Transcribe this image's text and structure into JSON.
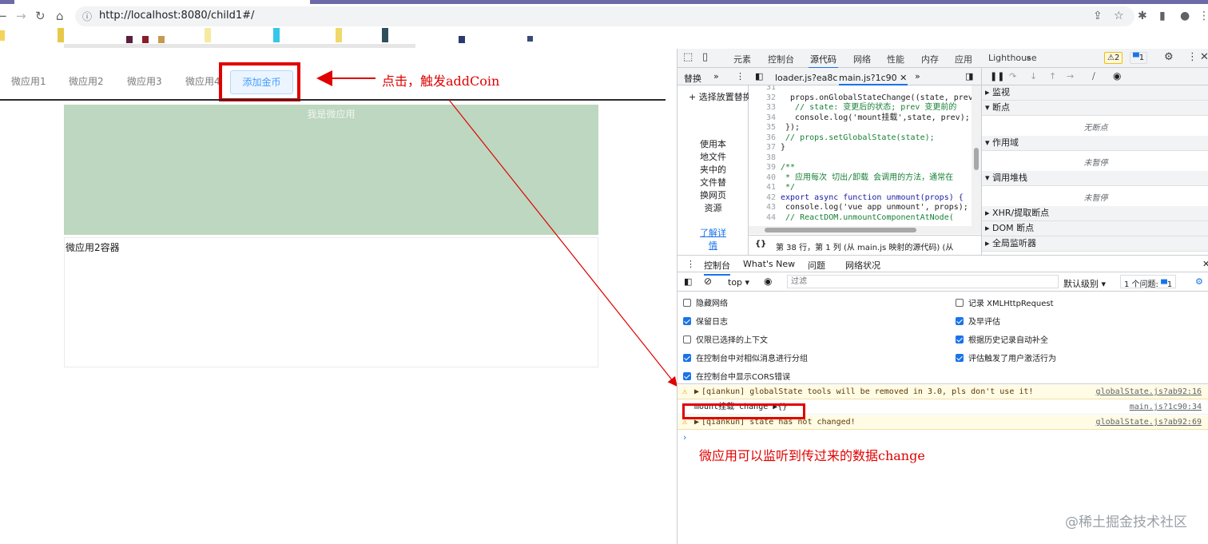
{
  "browser": {
    "url": "http://localhost:8080/child1#/"
  },
  "app": {
    "nav": [
      "微应用1",
      "微应用2",
      "微应用3",
      "微应用4"
    ],
    "add_coin": "添加金币",
    "micro1_text": "我是微应用",
    "micro2_text": "微应用2容器"
  },
  "annotations": {
    "click": "点击，触发addCoin",
    "listen": "微应用可以监听到传过来的数据change",
    "accent": "#e00000"
  },
  "devtools": {
    "tabs": [
      "元素",
      "控制台",
      "源代码",
      "网络",
      "性能",
      "内存",
      "应用",
      "Lighthouse"
    ],
    "selected_tab": "源代码",
    "warn_count": "2",
    "msg_count": "1",
    "sources": {
      "nav_tabs": [
        "替换"
      ],
      "select_folder": "选择放置替换",
      "nav_desc": [
        "使用本",
        "地文件",
        "夹中的",
        "文件替",
        "换网页",
        "资源"
      ],
      "learn_more": [
        "了解详",
        "情"
      ],
      "file_tabs": [
        "loader.js?ea8c",
        "main.js?1c90"
      ],
      "status": "第 38 行，第 1 列  (从 main.js 映射的源代码)  (从 ",
      "code": [
        {
          "n": "31",
          "t": ""
        },
        {
          "n": "32",
          "t": "  props.onGlobalStateChange((state, prev"
        },
        {
          "n": "33",
          "t": "   // state: 变更后的状态; prev 变更前的"
        },
        {
          "n": "34",
          "t": "   console.log('mount挂载',state, prev);"
        },
        {
          "n": "35",
          "t": " });"
        },
        {
          "n": "36",
          "t": " // props.setGlobalState(state);"
        },
        {
          "n": "37",
          "t": "}"
        },
        {
          "n": "38",
          "t": ""
        },
        {
          "n": "39",
          "t": "/**"
        },
        {
          "n": "40",
          "t": " * 应用每次 切出/卸载 会调用的方法，通常在"
        },
        {
          "n": "41",
          "t": " */"
        },
        {
          "n": "42",
          "t": "export async function unmount(props) {"
        },
        {
          "n": "43",
          "t": " console.log('vue app unmount', props);"
        },
        {
          "n": "44",
          "t": " // ReactDOM.unmountComponentAtNode("
        }
      ],
      "debugger": [
        {
          "title": "监视",
          "body": ""
        },
        {
          "title": "断点",
          "body": "无断点"
        },
        {
          "title": "作用域",
          "body": "未暂停"
        },
        {
          "title": "调用堆栈",
          "body": "未暂停"
        },
        {
          "title": "XHR/提取断点",
          "body": ""
        },
        {
          "title": "DOM 断点",
          "body": ""
        },
        {
          "title": "全局监听器",
          "body": ""
        }
      ]
    },
    "console": {
      "tabs": [
        "控制台",
        "What's New",
        "问题",
        "网络状况"
      ],
      "context": "top",
      "filter_placeholder": "过滤",
      "level": "默认级别",
      "issues": "1 个问题:",
      "issues_count": "1",
      "settings_left": [
        {
          "label": "隐藏网络",
          "checked": false
        },
        {
          "label": "保留日志",
          "checked": true
        },
        {
          "label": "仅限已选择的上下文",
          "checked": false
        },
        {
          "label": "在控制台中对相似消息进行分组",
          "checked": true
        },
        {
          "label": "在控制台中显示CORS错误",
          "checked": true
        }
      ],
      "settings_right": [
        {
          "label": "记录 XMLHttpRequest",
          "checked": false
        },
        {
          "label": "及早评估",
          "checked": true
        },
        {
          "label": "根据历史记录自动补全",
          "checked": true
        },
        {
          "label": "评估触发了用户激活行为",
          "checked": true
        }
      ],
      "messages": [
        {
          "type": "warn",
          "text": "[qiankun] globalState tools will be removed in 3.0, pls don't use it!",
          "src": "globalState.js?ab92:16"
        },
        {
          "type": "log",
          "text": "mount挂载 change ▶{}",
          "src": "main.js?1c90:34"
        },
        {
          "type": "warn",
          "text": "[qiankun] state has not changed!",
          "src": "globalState.js?ab92:69"
        }
      ]
    }
  },
  "watermark": "@稀土掘金技术社区"
}
